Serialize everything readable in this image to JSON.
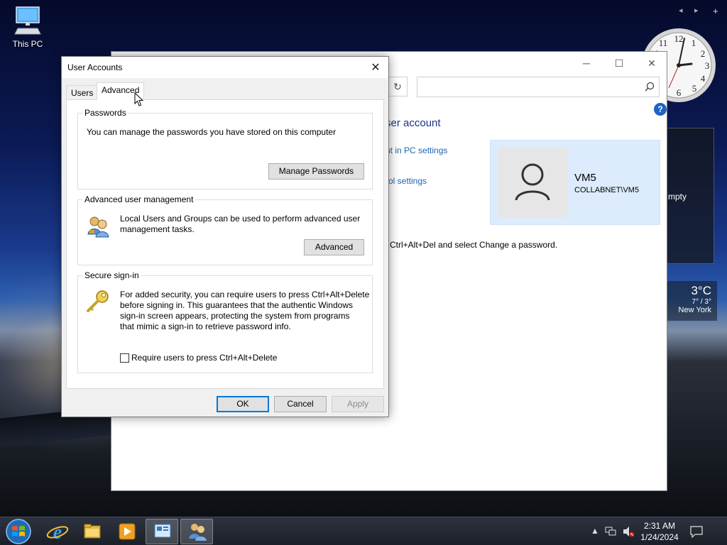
{
  "desktop": {
    "icon_label": "This PC"
  },
  "gadgets": {
    "nav_prev": "◂",
    "nav_next": "▸",
    "nav_add": "+",
    "panel_text": "mpty",
    "weather_temp": "3°C",
    "weather_range": "7° / 3°",
    "weather_city": "New York"
  },
  "cp_window": {
    "heading": "ser account",
    "link_pc_settings": "nt in PC settings",
    "link_control": "rol settings",
    "ctrl_alt_text": "Ctrl+Alt+Del and select Change a password.",
    "user_name": "VM5",
    "user_domain": "COLLABNET\\VM5",
    "help": "?"
  },
  "dialog": {
    "title": "User Accounts",
    "tabs": [
      {
        "label": "Users"
      },
      {
        "label": "Advanced"
      }
    ],
    "passwords": {
      "legend": "Passwords",
      "text": "You can manage the passwords you have stored on this computer",
      "button": "Manage Passwords"
    },
    "advanced_mgmt": {
      "legend": "Advanced user management",
      "text_line1": "Local Users and Groups can be used to perform advanced user",
      "text_line2": "management tasks.",
      "button": "Advanced"
    },
    "secure_signin": {
      "legend": "Secure sign-in",
      "text_line1": "For added security, you can require users to press Ctrl+Alt+Delete",
      "text_line2": "before signing in. This guarantees that the authentic Windows",
      "text_line3": "sign-in screen appears, protecting the system from programs",
      "text_line4": "that mimic a sign-in to retrieve password info.",
      "checkbox_label": "Require users to press Ctrl+Alt+Delete",
      "checkbox_checked": false
    },
    "buttons": {
      "ok": "OK",
      "cancel": "Cancel",
      "apply": "Apply"
    }
  },
  "taskbar": {
    "time": "2:31 AM",
    "date": "1/24/2024"
  },
  "colors": {
    "link": "#1e64b4",
    "heading": "#1e3287",
    "primary_border": "#0078d7",
    "user_tile_bg": "#dcecfc"
  }
}
